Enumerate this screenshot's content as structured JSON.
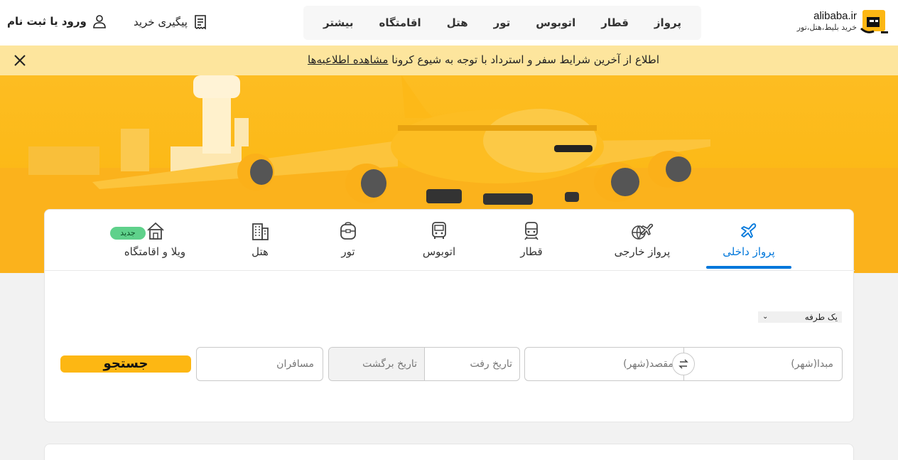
{
  "brand": {
    "name": "alibaba.ir",
    "tagline": "خرید بلیط،هتل،تور",
    "color": "#fdb713"
  },
  "nav": {
    "items": [
      "پرواز",
      "قطار",
      "اتوبوس",
      "تور",
      "هتل",
      "اقامتگاه",
      "بیشتر"
    ]
  },
  "header": {
    "track_label": "پیگیری خرید",
    "login_label": "ورود یا ثبت نام"
  },
  "notice": {
    "text": "اطلاع از آخرین شرایط سفر و استرداد با توجه به شیوع کرونا",
    "link": "مشاهده اطلاعیه‌ها"
  },
  "tabs": [
    {
      "label": "پرواز داخلی",
      "icon": "airplane-icon",
      "active": true
    },
    {
      "label": "پرواز خارجی",
      "icon": "globe-airplane-icon"
    },
    {
      "label": "قطار",
      "icon": "train-icon"
    },
    {
      "label": "اتوبوس",
      "icon": "bus-icon"
    },
    {
      "label": "تور",
      "icon": "suitcase-icon"
    },
    {
      "label": "هتل",
      "icon": "building-icon"
    },
    {
      "label": "ویلا و اقامتگاه",
      "icon": "house-icon",
      "badge": "جدید"
    }
  ],
  "search": {
    "trip_type": "یک طرفه",
    "origin_placeholder": "مبدا(شهر)",
    "destination_placeholder": "مقصد(شهر)",
    "depart_placeholder": "تاریخ رفت",
    "return_placeholder": "تاریخ برگشت",
    "passengers_placeholder": "مسافران",
    "button_label": "جستجو"
  },
  "colors": {
    "accent": "#0077db",
    "notice_bg": "#fde59d",
    "hero": "#fdbd22"
  }
}
